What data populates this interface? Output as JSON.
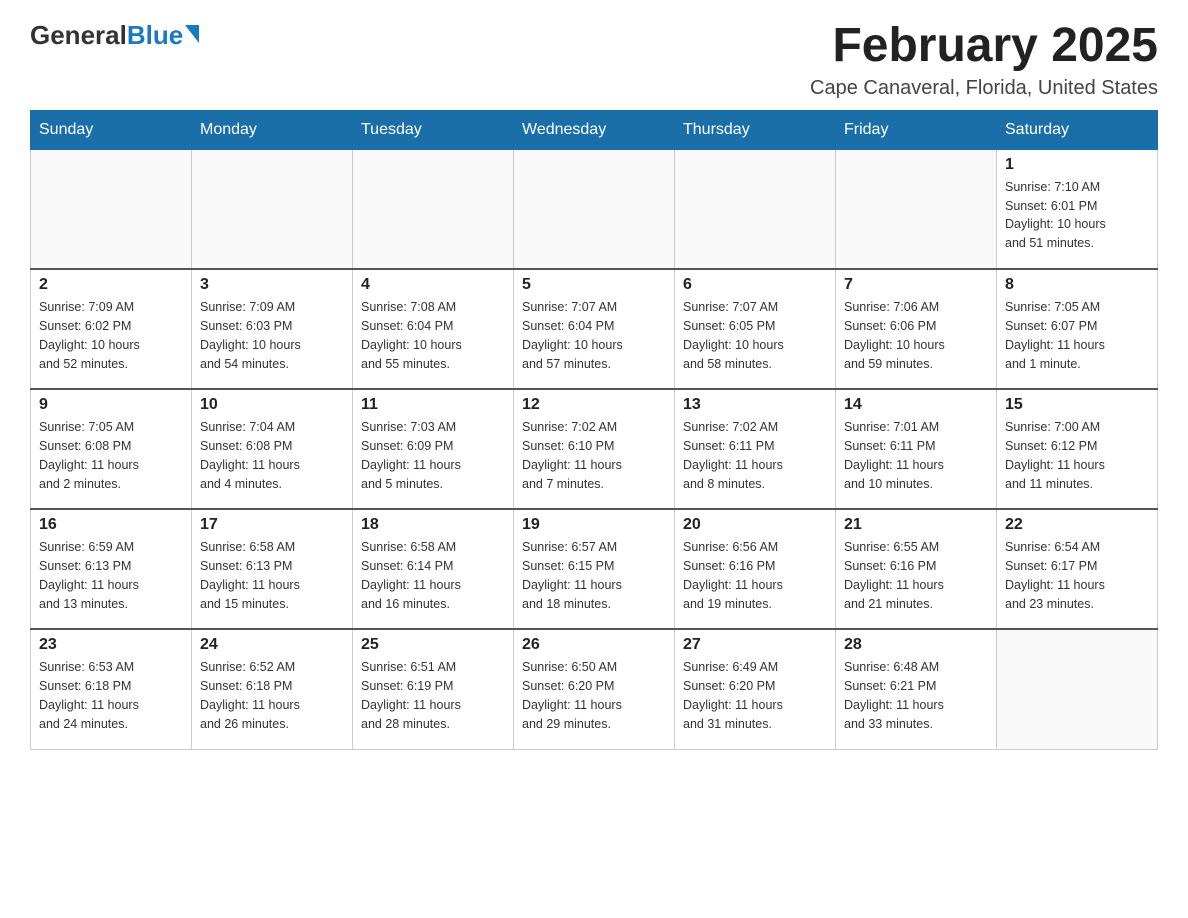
{
  "logo": {
    "general": "General",
    "blue": "Blue"
  },
  "title": {
    "month_year": "February 2025",
    "location": "Cape Canaveral, Florida, United States"
  },
  "weekdays": [
    "Sunday",
    "Monday",
    "Tuesday",
    "Wednesday",
    "Thursday",
    "Friday",
    "Saturday"
  ],
  "weeks": [
    [
      {
        "day": "",
        "info": ""
      },
      {
        "day": "",
        "info": ""
      },
      {
        "day": "",
        "info": ""
      },
      {
        "day": "",
        "info": ""
      },
      {
        "day": "",
        "info": ""
      },
      {
        "day": "",
        "info": ""
      },
      {
        "day": "1",
        "info": "Sunrise: 7:10 AM\nSunset: 6:01 PM\nDaylight: 10 hours\nand 51 minutes."
      }
    ],
    [
      {
        "day": "2",
        "info": "Sunrise: 7:09 AM\nSunset: 6:02 PM\nDaylight: 10 hours\nand 52 minutes."
      },
      {
        "day": "3",
        "info": "Sunrise: 7:09 AM\nSunset: 6:03 PM\nDaylight: 10 hours\nand 54 minutes."
      },
      {
        "day": "4",
        "info": "Sunrise: 7:08 AM\nSunset: 6:04 PM\nDaylight: 10 hours\nand 55 minutes."
      },
      {
        "day": "5",
        "info": "Sunrise: 7:07 AM\nSunset: 6:04 PM\nDaylight: 10 hours\nand 57 minutes."
      },
      {
        "day": "6",
        "info": "Sunrise: 7:07 AM\nSunset: 6:05 PM\nDaylight: 10 hours\nand 58 minutes."
      },
      {
        "day": "7",
        "info": "Sunrise: 7:06 AM\nSunset: 6:06 PM\nDaylight: 10 hours\nand 59 minutes."
      },
      {
        "day": "8",
        "info": "Sunrise: 7:05 AM\nSunset: 6:07 PM\nDaylight: 11 hours\nand 1 minute."
      }
    ],
    [
      {
        "day": "9",
        "info": "Sunrise: 7:05 AM\nSunset: 6:08 PM\nDaylight: 11 hours\nand 2 minutes."
      },
      {
        "day": "10",
        "info": "Sunrise: 7:04 AM\nSunset: 6:08 PM\nDaylight: 11 hours\nand 4 minutes."
      },
      {
        "day": "11",
        "info": "Sunrise: 7:03 AM\nSunset: 6:09 PM\nDaylight: 11 hours\nand 5 minutes."
      },
      {
        "day": "12",
        "info": "Sunrise: 7:02 AM\nSunset: 6:10 PM\nDaylight: 11 hours\nand 7 minutes."
      },
      {
        "day": "13",
        "info": "Sunrise: 7:02 AM\nSunset: 6:11 PM\nDaylight: 11 hours\nand 8 minutes."
      },
      {
        "day": "14",
        "info": "Sunrise: 7:01 AM\nSunset: 6:11 PM\nDaylight: 11 hours\nand 10 minutes."
      },
      {
        "day": "15",
        "info": "Sunrise: 7:00 AM\nSunset: 6:12 PM\nDaylight: 11 hours\nand 11 minutes."
      }
    ],
    [
      {
        "day": "16",
        "info": "Sunrise: 6:59 AM\nSunset: 6:13 PM\nDaylight: 11 hours\nand 13 minutes."
      },
      {
        "day": "17",
        "info": "Sunrise: 6:58 AM\nSunset: 6:13 PM\nDaylight: 11 hours\nand 15 minutes."
      },
      {
        "day": "18",
        "info": "Sunrise: 6:58 AM\nSunset: 6:14 PM\nDaylight: 11 hours\nand 16 minutes."
      },
      {
        "day": "19",
        "info": "Sunrise: 6:57 AM\nSunset: 6:15 PM\nDaylight: 11 hours\nand 18 minutes."
      },
      {
        "day": "20",
        "info": "Sunrise: 6:56 AM\nSunset: 6:16 PM\nDaylight: 11 hours\nand 19 minutes."
      },
      {
        "day": "21",
        "info": "Sunrise: 6:55 AM\nSunset: 6:16 PM\nDaylight: 11 hours\nand 21 minutes."
      },
      {
        "day": "22",
        "info": "Sunrise: 6:54 AM\nSunset: 6:17 PM\nDaylight: 11 hours\nand 23 minutes."
      }
    ],
    [
      {
        "day": "23",
        "info": "Sunrise: 6:53 AM\nSunset: 6:18 PM\nDaylight: 11 hours\nand 24 minutes."
      },
      {
        "day": "24",
        "info": "Sunrise: 6:52 AM\nSunset: 6:18 PM\nDaylight: 11 hours\nand 26 minutes."
      },
      {
        "day": "25",
        "info": "Sunrise: 6:51 AM\nSunset: 6:19 PM\nDaylight: 11 hours\nand 28 minutes."
      },
      {
        "day": "26",
        "info": "Sunrise: 6:50 AM\nSunset: 6:20 PM\nDaylight: 11 hours\nand 29 minutes."
      },
      {
        "day": "27",
        "info": "Sunrise: 6:49 AM\nSunset: 6:20 PM\nDaylight: 11 hours\nand 31 minutes."
      },
      {
        "day": "28",
        "info": "Sunrise: 6:48 AM\nSunset: 6:21 PM\nDaylight: 11 hours\nand 33 minutes."
      },
      {
        "day": "",
        "info": ""
      }
    ]
  ]
}
